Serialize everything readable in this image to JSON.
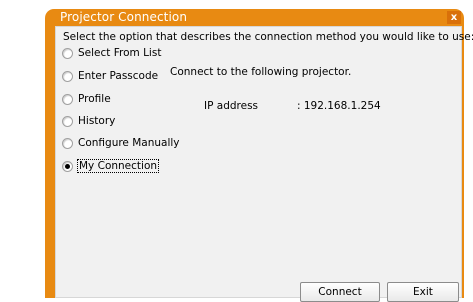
{
  "window": {
    "title": "Projector Connection",
    "close_label": "x"
  },
  "instruction": "Select the option that describes the connection method you would like to use:",
  "options": [
    {
      "label": "Select From List",
      "checked": false
    },
    {
      "label": "Enter Passcode",
      "checked": false
    },
    {
      "label": "Profile",
      "checked": false
    },
    {
      "label": "History",
      "checked": false
    },
    {
      "label": "Configure Manually",
      "checked": false
    },
    {
      "label": "My Connection",
      "checked": true
    }
  ],
  "details": {
    "connect_text": "Connect to the following projector.",
    "ip_label": "IP address",
    "ip_value": ":  192.168.1.254"
  },
  "buttons": {
    "connect": "Connect",
    "exit": "Exit"
  },
  "colors": {
    "frame": "#e88a12",
    "client": "#f1f1f1",
    "title_text": "#ffffff"
  }
}
